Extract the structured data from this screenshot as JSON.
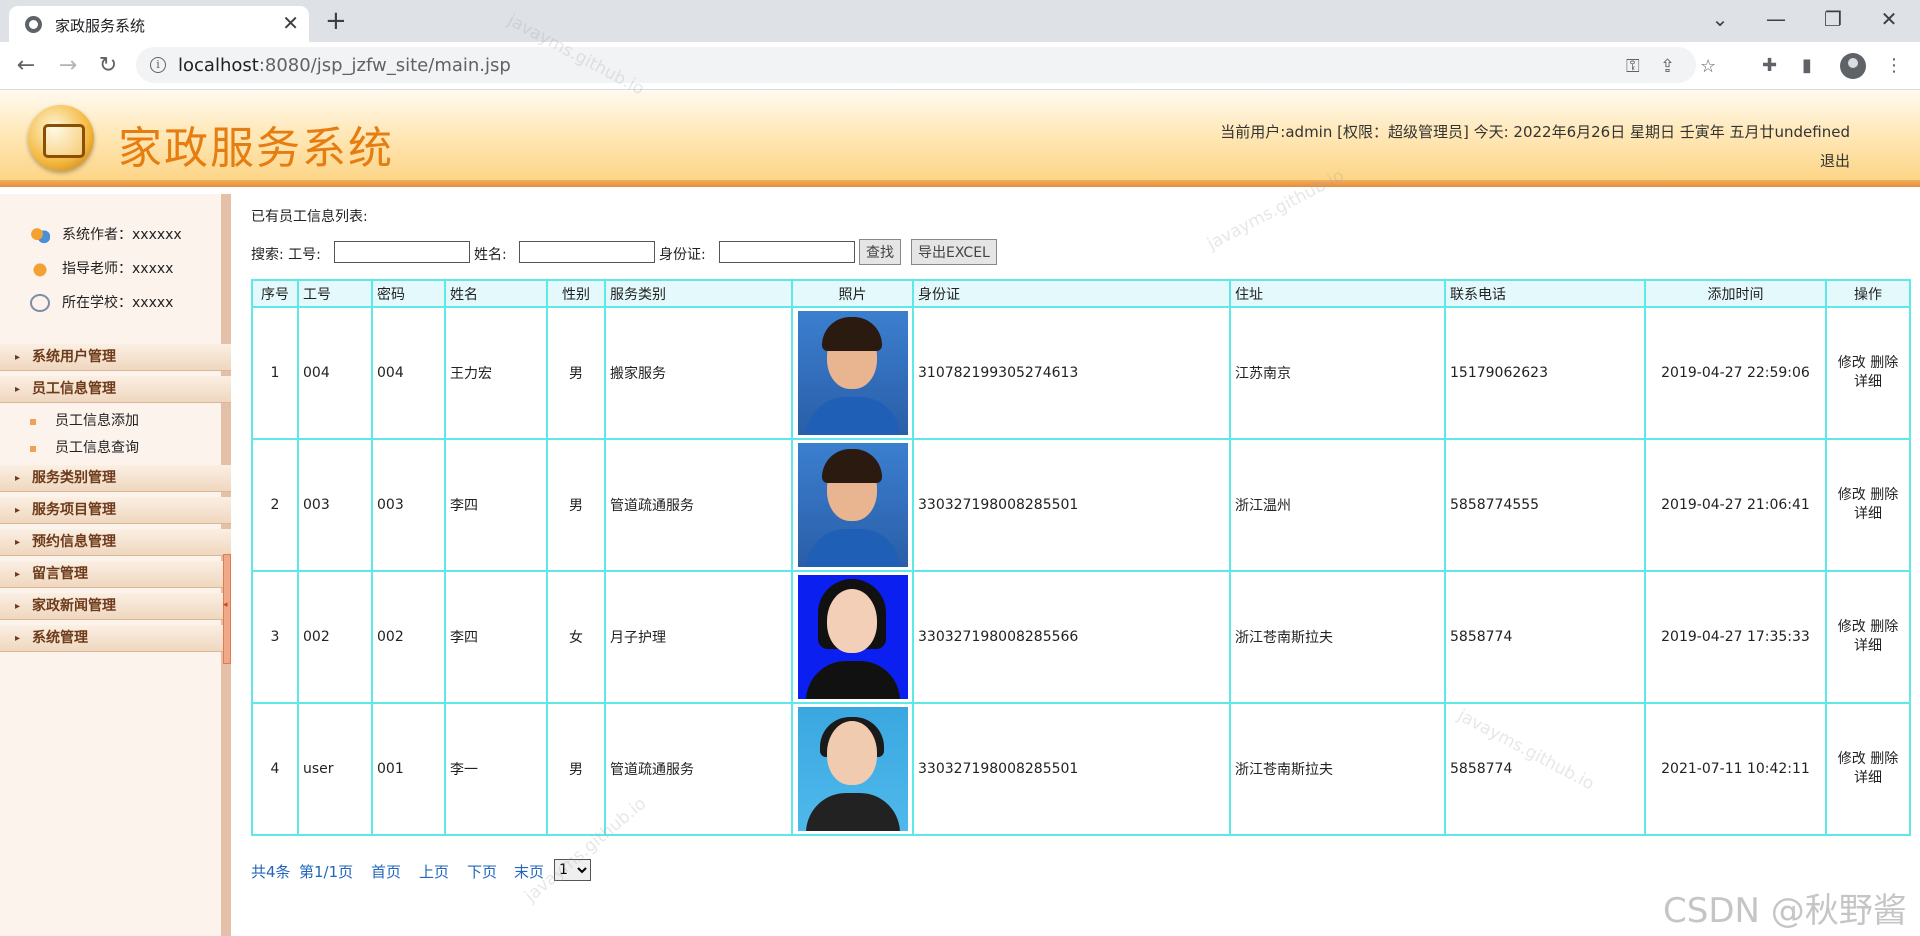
{
  "browser": {
    "tab_title": "家政服务系统",
    "url_host": "localhost",
    "url_rest": ":8080/jsp_jzfw_site/main.jsp"
  },
  "header": {
    "title": "家政服务系统",
    "user_info": "当前用户:admin [权限：超级管理员] 今天:   2022年6月26日 星期日 壬寅年 五月廿undefined",
    "logout": "退出"
  },
  "sidebar": {
    "info": [
      {
        "label": "系统作者：xxxxxx"
      },
      {
        "label": "指导老师：xxxxx"
      },
      {
        "label": "所在学校：xxxxx"
      }
    ],
    "menu": [
      {
        "label": "系统用户管理"
      },
      {
        "label": "员工信息管理"
      },
      {
        "label": "员工信息添加"
      },
      {
        "label": "员工信息查询"
      },
      {
        "label": "服务类别管理"
      },
      {
        "label": "服务项目管理"
      },
      {
        "label": "预约信息管理"
      },
      {
        "label": "留言管理"
      },
      {
        "label": "家政新闻管理"
      },
      {
        "label": "系统管理"
      }
    ]
  },
  "main": {
    "list_title": "已有员工信息列表:",
    "search": {
      "label": "搜索: 工号:",
      "name_label": "姓名:",
      "id_label": "身份证:",
      "find_btn": "查找",
      "export_btn": "导出EXCEL",
      "worker_no_value": "",
      "name_value": "",
      "id_value": ""
    },
    "columns": [
      "序号",
      "工号",
      "密码",
      "姓名",
      "性别",
      "服务类别",
      "照片",
      "身份证",
      "住址",
      "联系电话",
      "添加时间",
      "操作"
    ],
    "rows": [
      {
        "seq": "1",
        "no": "004",
        "pwd": "004",
        "name": "王力宏",
        "sex": "男",
        "service": "搬家服务",
        "photo": "portrait-man",
        "idcard": "310782199305274613",
        "addr": "江苏南京",
        "phone": "15179062623",
        "time": "2019-04-27 22:59:06"
      },
      {
        "seq": "2",
        "no": "003",
        "pwd": "003",
        "name": "李四",
        "sex": "男",
        "service": "管道疏通服务",
        "photo": "portrait-man",
        "idcard": "330327198008285501",
        "addr": "浙江温州",
        "phone": "5858774555",
        "time": "2019-04-27 21:06:41"
      },
      {
        "seq": "3",
        "no": "002",
        "pwd": "002",
        "name": "李四",
        "sex": "女",
        "service": "月子护理",
        "photo": "portrait-woman-blue",
        "idcard": "330327198008285566",
        "addr": "浙江苍南斯拉夫",
        "phone": "5858774",
        "time": "2019-04-27 17:35:33"
      },
      {
        "seq": "4",
        "no": "user",
        "pwd": "001",
        "name": "李一",
        "sex": "男",
        "service": "管道疏通服务",
        "photo": "portrait-woman-sky",
        "idcard": "330327198008285501",
        "addr": "浙江苍南斯拉夫",
        "phone": "5858774",
        "time": "2021-07-11 10:42:11"
      }
    ],
    "ops": {
      "edit": "修改",
      "delete": "删除",
      "detail": "详细"
    },
    "pager": {
      "total": "共4条",
      "page": "第1/1页",
      "first": "首页",
      "prev": "上页",
      "next": "下页",
      "last": "末页",
      "selected": "1"
    }
  },
  "watermark": "javayms.github.io",
  "csdn_mark": "CSDN @秋野酱",
  "colors": {
    "accent": "#e57d10",
    "table_border": "#5ee8ea",
    "link": "#2266bb"
  }
}
